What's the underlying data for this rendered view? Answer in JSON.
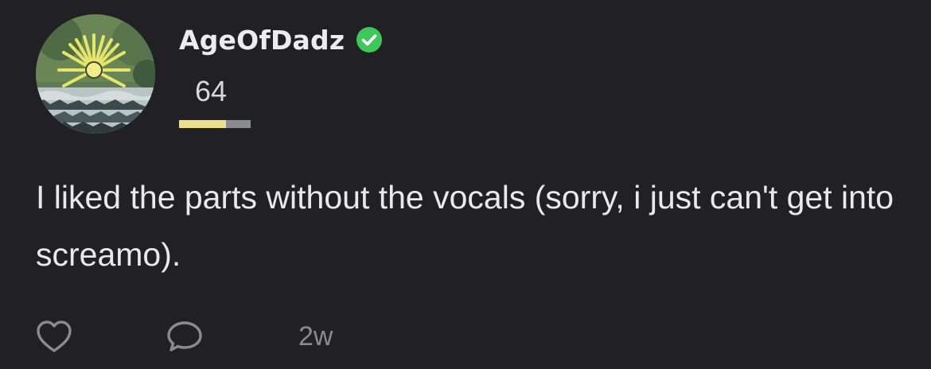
{
  "comment": {
    "author": {
      "username": "AgeOfDadz",
      "verified": true,
      "avatar_icon": "sunburst-landscape-avatar",
      "score": "64",
      "score_fraction": 0.65
    },
    "text": "I liked the parts without the vocals (sorry, i just can't get into screamo).",
    "timestamp": "2w",
    "actions": {
      "like_icon": "heart-outline-icon",
      "reply_icon": "speech-bubble-icon"
    }
  },
  "colors": {
    "background": "#212125",
    "verified_green": "#3ec85a",
    "score_fill": "#ece08a",
    "score_track": "#8b8c91",
    "icon_gray": "#8a8a90"
  }
}
